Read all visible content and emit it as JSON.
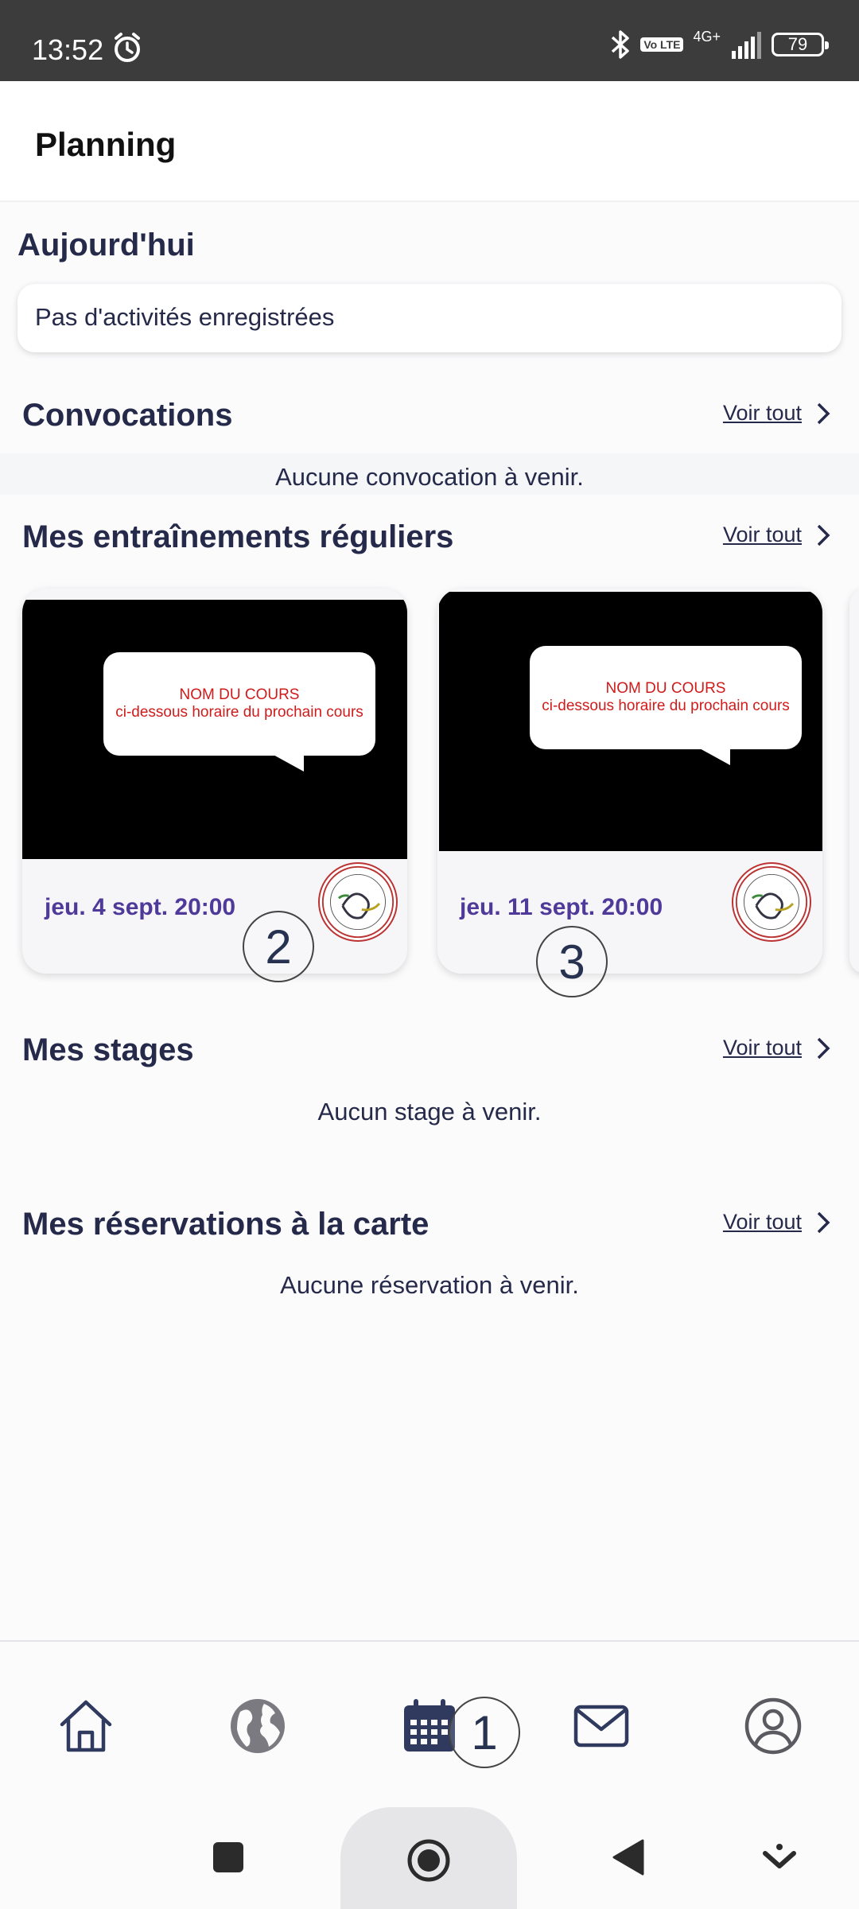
{
  "status_bar": {
    "time": "13:52",
    "network": "4G+",
    "volte": "Vo LTE",
    "battery": "79"
  },
  "header": {
    "title": "Planning"
  },
  "today": {
    "title": "Aujourd'hui",
    "empty": "Pas d'activités enregistrées"
  },
  "convocations": {
    "title": "Convocations",
    "see_all": "Voir tout",
    "empty": "Aucune convocation à venir."
  },
  "regular": {
    "title": "Mes entraînements réguliers",
    "see_all": "Voir tout",
    "cards": [
      {
        "line1": "NOM DU COURS",
        "line2": "ci-dessous horaire du prochain cours",
        "date": "jeu. 4 sept. 20:00"
      },
      {
        "line1": "NOM DU COURS",
        "line2": "ci-dessous horaire du prochain cours",
        "date": "jeu. 11 sept. 20:00"
      }
    ]
  },
  "stages": {
    "title": "Mes stages",
    "see_all": "Voir tout",
    "empty": "Aucun stage à venir."
  },
  "reservations": {
    "title": "Mes réservations à la carte",
    "see_all": "Voir tout",
    "empty": "Aucune réservation à venir."
  },
  "annotations": [
    "1",
    "2",
    "3"
  ],
  "bottom_nav": [
    {
      "icon": "home-icon"
    },
    {
      "icon": "globe-icon"
    },
    {
      "icon": "calendar-icon",
      "active": true
    },
    {
      "icon": "mail-icon"
    },
    {
      "icon": "profile-icon"
    }
  ],
  "colors": {
    "heading": "#262a4a",
    "date": "#4f3a9a",
    "bubble_text": "#d01b1b",
    "status_bar": "#3c3c3c"
  }
}
